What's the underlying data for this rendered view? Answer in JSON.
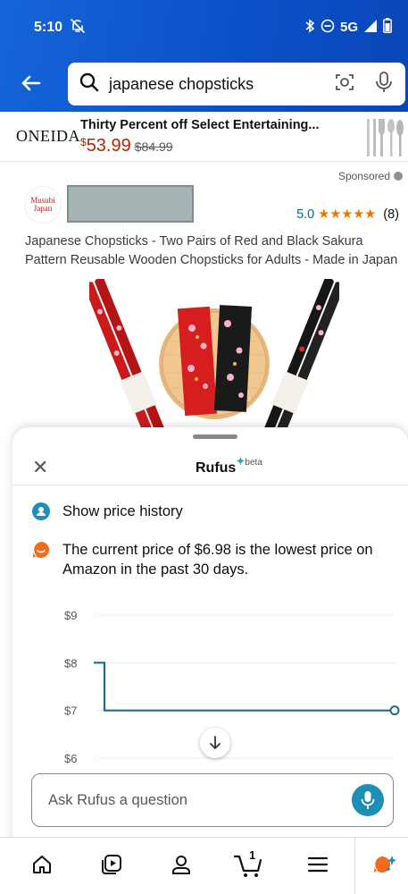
{
  "status_bar": {
    "time": "5:10",
    "network": "5G"
  },
  "search": {
    "query": "japanese chopsticks"
  },
  "ad_banner": {
    "brand": "ONEIDA",
    "title": "Thirty Percent off Select Entertaining...",
    "currency": "$",
    "price": "53.99",
    "old_price": "$84.99",
    "sponsored": "Sponsored"
  },
  "product": {
    "seller_logo_text_1": "Musubi",
    "seller_logo_text_2": "Japan",
    "rating": "5.0",
    "stars": "★★★★★",
    "review_count": "(8)",
    "title": "Japanese Chopsticks - Two Pairs of Red and Black Sakura Pattern Reusable Wooden Chopsticks for Adults - Made in Japan"
  },
  "rufus": {
    "title": "Rufus",
    "beta": "beta",
    "user_message": "Show price history",
    "bot_message": "The current price of $6.98 is the lowest price on Amazon in the past 30 days.",
    "input_placeholder": "Ask Rufus a question"
  },
  "chart_data": {
    "type": "line",
    "title": "",
    "xlabel": "",
    "ylabel": "",
    "y_ticks": [
      "$9",
      "$8",
      "$7",
      "$6"
    ],
    "ylim": [
      6,
      9
    ],
    "x": [
      0,
      0.03,
      1
    ],
    "values": [
      8,
      7,
      7
    ],
    "series_color": "#1a6e87",
    "grid": true
  },
  "bottom_nav": {
    "cart_count": "1",
    "items": [
      "home-icon",
      "video-icon",
      "account-icon",
      "cart-icon",
      "menu-icon",
      "rufus-icon"
    ]
  },
  "colors": {
    "header": "#0b4fc7",
    "price": "#B12704",
    "link": "#007185",
    "star": "#e67a00",
    "rufus_accent": "#1b8fb6"
  }
}
